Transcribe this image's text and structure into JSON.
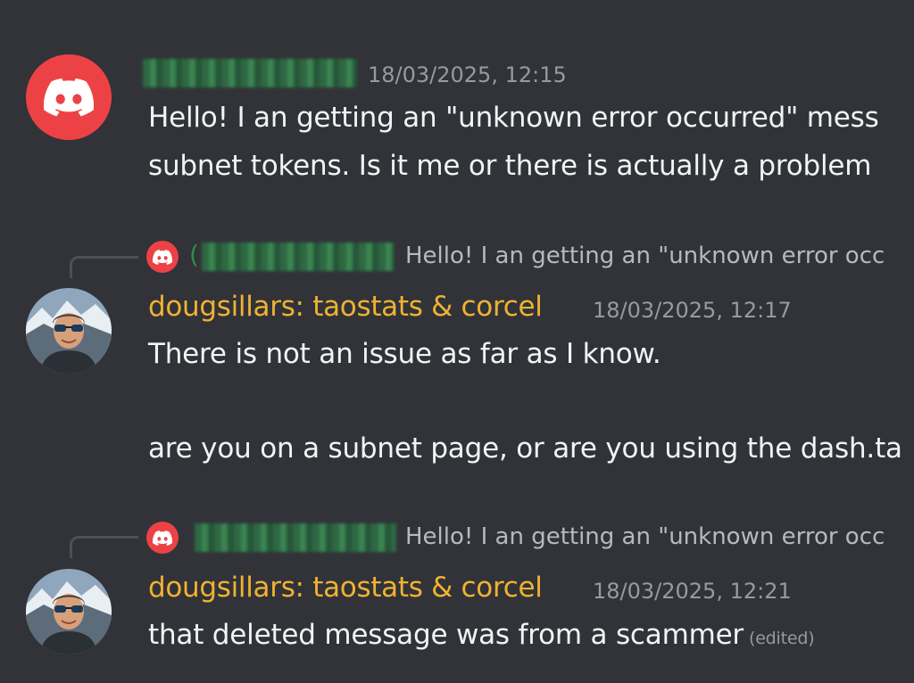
{
  "messages": [
    {
      "id": "m1",
      "timestamp": "18/03/2025, 12:15",
      "lines": [
        "Hello!  I an getting an \"unknown error occurred\" mess",
        "subnet tokens. Is it me or there is actually a problem"
      ]
    },
    {
      "id": "m2",
      "reply_preview": "Hello!  I an getting an \"unknown error occ",
      "username": "dougsillars: taostats & corcel",
      "timestamp": "18/03/2025, 12:17",
      "lines": [
        "There is not an issue as far as I know.",
        "are you on a subnet page, or are you using the dash.ta"
      ]
    },
    {
      "id": "m3",
      "reply_preview": "Hello!  I an getting an \"unknown error occ",
      "username": "dougsillars: taostats & corcel",
      "timestamp": "18/03/2025, 12:21",
      "lines": [
        "that deleted message was from a scammer"
      ],
      "edited_label": "(edited)"
    }
  ],
  "icons": {
    "discord_logo": "discord-icon",
    "user_avatar": "user-avatar"
  },
  "colors": {
    "background": "#313338",
    "discord_red": "#ed4245",
    "username_gold": "#f0b232",
    "timestamp_gray": "#949ba4",
    "text": "#f2f3f5"
  }
}
